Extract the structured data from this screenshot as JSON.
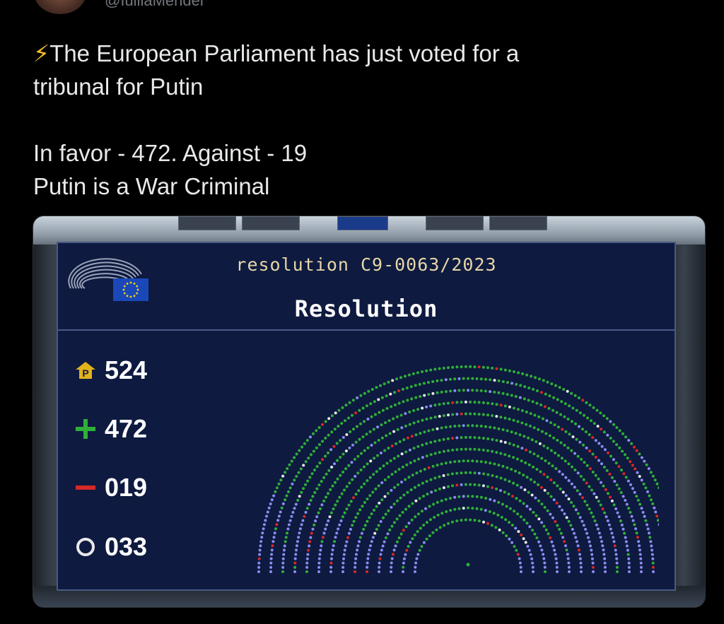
{
  "tweet": {
    "handle": "@IuliiaMendel",
    "line1": "The European Parliament has just voted for a",
    "line2": "tribunal for Putin",
    "line3": "In favor - 472. Against - 19",
    "line4": "Putin is a War Criminal"
  },
  "vote_screen": {
    "resolution_ref": "resolution C9-0063/2023",
    "title": "Resolution",
    "present": "524",
    "in_favor": "472",
    "against": "019",
    "abstain": "033"
  },
  "colors": {
    "favor": "#2fae3a",
    "against": "#d62828",
    "abstain": "#e8e8e8",
    "absent": "#8a8cf0",
    "panel": "#0e1a3f",
    "eu_flag": "#1a48b8",
    "eu_star": "#f6d21a"
  }
}
